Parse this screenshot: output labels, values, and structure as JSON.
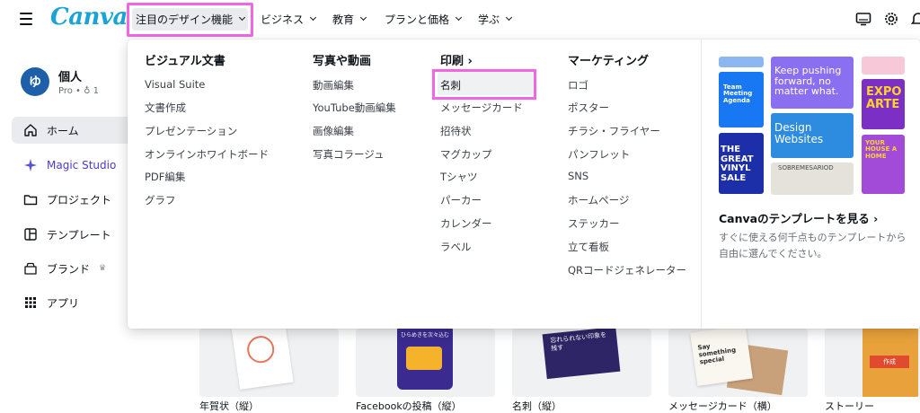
{
  "header": {
    "logo": "Canva",
    "nav": [
      {
        "label": "注目のデザイン機能"
      },
      {
        "label": "ビジネス"
      },
      {
        "label": "教育"
      },
      {
        "label": "プランと価格"
      },
      {
        "label": "学ぶ"
      }
    ],
    "icons": [
      "menu-icon",
      "monitor-icon",
      "settings-icon",
      "bell-icon"
    ]
  },
  "sidebar": {
    "account": {
      "initial": "ゆ",
      "name": "個人",
      "plan": "Pro • ♁ 1"
    },
    "items": [
      {
        "label": "ホーム",
        "icon": "home-icon"
      },
      {
        "label": "Magic Studio",
        "icon": "sparkle-icon"
      },
      {
        "label": "プロジェクト",
        "icon": "folder-icon"
      },
      {
        "label": "テンプレート",
        "icon": "template-icon"
      },
      {
        "label": "ブランド",
        "icon": "brand-icon"
      },
      {
        "label": "アプリ",
        "icon": "apps-icon"
      }
    ]
  },
  "dropdown": {
    "columns": [
      {
        "heading": "ビジュアル文書",
        "items": [
          "Visual Suite",
          "文書作成",
          "プレゼンテーション",
          "オンラインホワイトボード",
          "PDF編集",
          "グラフ"
        ]
      },
      {
        "heading": "写真や動画",
        "items": [
          "動画編集",
          "YouTube動画編集",
          "画像編集",
          "写真コラージュ"
        ]
      },
      {
        "heading": "印刷 ›",
        "items": [
          "名刺",
          "メッセージカード",
          "招待状",
          "マグカップ",
          "Tシャツ",
          "パーカー",
          "カレンダー",
          "ラベル"
        ]
      },
      {
        "heading": "マーケティング",
        "items": [
          "ロゴ",
          "ポスター",
          "チラシ・フライヤー",
          "パンフレット",
          "SNS",
          "ホームページ",
          "ステッカー",
          "立て看板",
          "QRコードジェネレーター"
        ]
      }
    ],
    "promo": {
      "tiles": {
        "team": "Team Meeting Agenda",
        "keep": "Keep pushing forward, no matter what.",
        "expo": "EXPO ARTE",
        "design": "Design Websites",
        "sobre": "SOBREMESARIOD",
        "great": "THE GREAT VINYL SALE",
        "house": "YOUR HOUSE A HOME"
      },
      "title": "Canvaのテンプレートを見る ›",
      "description": "すぐに使える何千点ものテンプレートから自由に選んでください。"
    }
  },
  "background_cards": [
    {
      "label": "年賀状（縦）"
    },
    {
      "label": "Facebookの投稿（縦）",
      "thumb_text": "ひらめきを次々込む"
    },
    {
      "label": "名刺（縦）",
      "thumb_text": "忘れられない印象を残す"
    },
    {
      "label": "メッセージカード（横）",
      "thumb_text": "Say something special"
    },
    {
      "label": "ストーリー",
      "thumb_text": "作成"
    }
  ]
}
